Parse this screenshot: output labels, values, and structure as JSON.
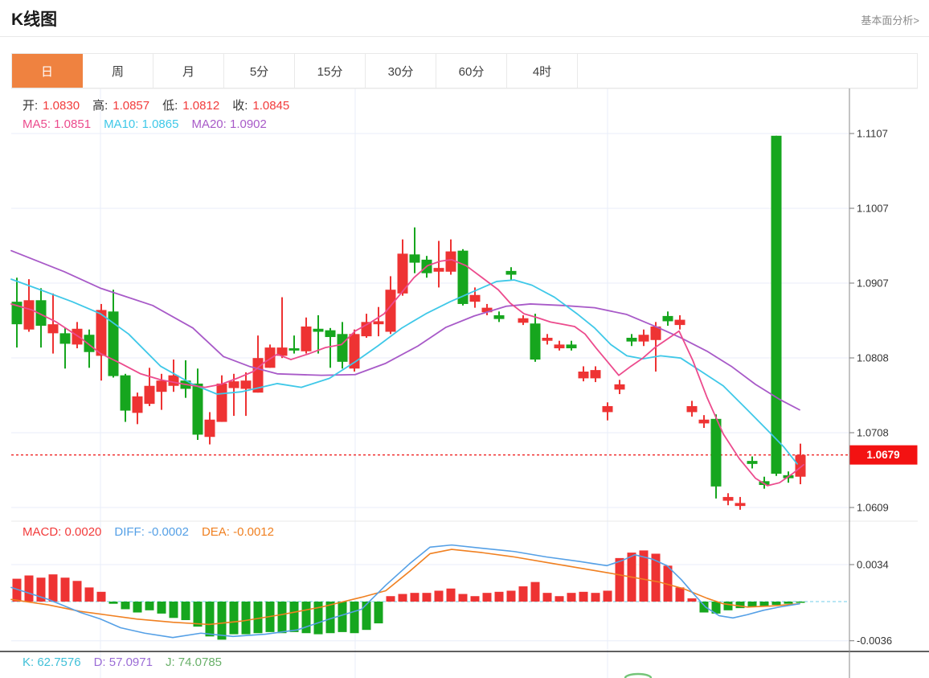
{
  "header": {
    "title": "K线图",
    "link_label": "基本面分析>"
  },
  "tabs": {
    "items": [
      "日",
      "周",
      "月",
      "5分",
      "15分",
      "30分",
      "60分",
      "4时"
    ],
    "active_index": 0
  },
  "colors": {
    "accent_tab": "#ef8240",
    "candle_red": "#ee3333",
    "candle_green": "#16a61e",
    "ma5": "#ec4b8d",
    "ma10": "#3fc8e8",
    "ma20": "#a85ac8",
    "value_red": "#f23b3b",
    "diff_blue": "#55a0e6",
    "dea_orange": "#f08021",
    "kdj_k": "#40c0d8",
    "kdj_d": "#9b6cd6",
    "kdj_j": "#69b069",
    "badge_red": "#f31212",
    "grid": "#e8eef8",
    "zero_dash": "#8ed7ee"
  },
  "main_chart": {
    "ohlc": [
      {
        "label": "开:",
        "value": "1.0830"
      },
      {
        "label": "高:",
        "value": "1.0857"
      },
      {
        "label": "低:",
        "value": "1.0812"
      },
      {
        "label": "收:",
        "value": "1.0845"
      }
    ],
    "ma_items": [
      {
        "text": "MA5: 1.0851",
        "color_key": "ma5"
      },
      {
        "text": "MA10: 1.0865",
        "color_key": "ma10"
      },
      {
        "text": "MA20: 1.0902",
        "color_key": "ma20"
      }
    ],
    "y_axis": [
      "1.1107",
      "1.1007",
      "1.0907",
      "1.0808",
      "1.0708",
      "1.0609"
    ],
    "last_price": "1.0679"
  },
  "macd_panel": {
    "items": [
      {
        "text": "MACD: 0.0020",
        "color_key": "value_red"
      },
      {
        "text": "DIFF: -0.0002",
        "color_key": "diff_blue"
      },
      {
        "text": "DEA: -0.0012",
        "color_key": "dea_orange"
      }
    ],
    "y_axis": [
      "0.0034",
      "-0.0036"
    ]
  },
  "kdj_panel": {
    "items": [
      {
        "text": "K: 62.7576",
        "color_key": "kdj_k"
      },
      {
        "text": "D: 57.0971",
        "color_key": "kdj_d"
      },
      {
        "text": "J: 74.0785",
        "color_key": "kdj_j"
      }
    ]
  },
  "chart_data": {
    "type": "candlestick",
    "title": "K线图 日线 (EUR/USD style quotes)",
    "price_axis": {
      "ticks": [
        1.1107,
        1.1007,
        1.0907,
        1.0808,
        1.0708,
        1.0609
      ],
      "last_price": 1.0679
    },
    "macd_axis": {
      "ticks": [
        0.0034,
        -0.0036
      ]
    },
    "candles_note": "each candle = [color r|g, bodyTop, bodyBottom, high, low] in price units, left to right",
    "candles": [
      [
        "g",
        1.0883,
        1.0853,
        1.0915,
        1.0822
      ],
      [
        "r",
        1.0885,
        1.0846,
        1.0913,
        1.0843
      ],
      [
        "g",
        1.0885,
        1.0851,
        1.0901,
        1.0822
      ],
      [
        "r",
        1.0853,
        1.0841,
        1.0894,
        1.0814
      ],
      [
        "g",
        1.0841,
        1.0827,
        1.0848,
        1.0794
      ],
      [
        "r",
        1.0847,
        1.0826,
        1.0856,
        1.0821
      ],
      [
        "g",
        1.0839,
        1.0816,
        1.0846,
        1.0795
      ],
      [
        "r",
        1.0872,
        1.0811,
        1.088,
        1.0778
      ],
      [
        "g",
        1.087,
        1.0784,
        1.0899,
        1.0782
      ],
      [
        "g",
        1.0785,
        1.0738,
        1.0787,
        1.0723
      ],
      [
        "r",
        1.0757,
        1.0735,
        1.0762,
        1.072
      ],
      [
        "r",
        1.0771,
        1.0747,
        1.0795,
        1.0744
      ],
      [
        "r",
        1.0778,
        1.0763,
        1.0787,
        1.0739
      ],
      [
        "r",
        1.0785,
        1.0771,
        1.0806,
        1.0763
      ],
      [
        "g",
        1.0778,
        1.0767,
        1.0805,
        1.0755
      ],
      [
        "g",
        1.0774,
        1.0706,
        1.0794,
        1.0699
      ],
      [
        "r",
        1.0726,
        1.0703,
        1.0736,
        1.0693
      ],
      [
        "r",
        1.0774,
        1.0723,
        1.0785,
        1.0723
      ],
      [
        "r",
        1.0777,
        1.0768,
        1.0787,
        1.0731
      ],
      [
        "r",
        1.0778,
        1.0767,
        1.0789,
        1.0731
      ],
      [
        "r",
        1.0808,
        1.0762,
        1.0838,
        1.0762
      ],
      [
        "r",
        1.0822,
        1.0795,
        1.0826,
        1.0795
      ],
      [
        "r",
        1.0822,
        1.0811,
        1.0889,
        1.0808
      ],
      [
        "g",
        1.0821,
        1.0818,
        1.0838,
        1.0814
      ],
      [
        "r",
        1.085,
        1.0817,
        1.0862,
        1.0814
      ],
      [
        "g",
        1.0847,
        1.0843,
        1.0865,
        1.0814
      ],
      [
        "g",
        1.0845,
        1.0836,
        1.0848,
        1.0795
      ],
      [
        "g",
        1.084,
        1.0803,
        1.0856,
        1.0794
      ],
      [
        "r",
        1.084,
        1.0794,
        1.0846,
        1.079
      ],
      [
        "r",
        1.0856,
        1.0837,
        1.0867,
        1.0835
      ],
      [
        "r",
        1.0857,
        1.0853,
        1.0876,
        1.0837
      ],
      [
        "r",
        1.0899,
        1.0843,
        1.0917,
        1.084
      ],
      [
        "r",
        1.0947,
        1.0894,
        1.0966,
        1.0891
      ],
      [
        "g",
        1.0946,
        1.0935,
        1.0982,
        1.0921
      ],
      [
        "g",
        1.0939,
        1.0921,
        1.0944,
        1.0915
      ],
      [
        "r",
        1.0928,
        1.0923,
        1.0964,
        1.0902
      ],
      [
        "r",
        1.095,
        1.0923,
        1.0966,
        1.0919
      ],
      [
        "g",
        1.0951,
        1.088,
        1.0953,
        1.0878
      ],
      [
        "r",
        1.0892,
        1.0883,
        1.0902,
        1.0875
      ],
      [
        "r",
        1.0875,
        1.0869,
        1.088,
        1.0865
      ],
      [
        "g",
        1.0865,
        1.086,
        1.087,
        1.0856
      ],
      [
        "g",
        1.0924,
        1.0919,
        1.0929,
        1.0912
      ],
      [
        "r",
        1.0861,
        1.0855,
        1.0865,
        1.0852
      ],
      [
        "g",
        1.0854,
        1.0806,
        1.0867,
        1.0803
      ],
      [
        "r",
        1.0835,
        1.0831,
        1.084,
        1.0826
      ],
      [
        "r",
        1.0826,
        1.0821,
        1.0831,
        1.0818
      ],
      [
        "g",
        1.0826,
        1.0821,
        1.0831,
        1.0818
      ],
      [
        "r",
        1.079,
        1.0781,
        1.0797,
        1.0777
      ],
      [
        "r",
        1.0792,
        1.0781,
        1.0797,
        1.0776
      ],
      [
        "r",
        1.0744,
        1.0736,
        1.0749,
        1.0725
      ],
      [
        "r",
        1.0773,
        1.0766,
        1.0779,
        1.076
      ],
      [
        "g",
        1.0835,
        1.083,
        1.084,
        1.0824
      ],
      [
        "r",
        1.0839,
        1.083,
        1.0846,
        1.0824
      ],
      [
        "r",
        1.085,
        1.0832,
        1.0856,
        1.079
      ],
      [
        "g",
        1.0864,
        1.0857,
        1.087,
        1.0851
      ],
      [
        "r",
        1.0859,
        1.0852,
        1.0865,
        1.0846
      ],
      [
        "r",
        1.0744,
        1.0736,
        1.0751,
        1.073
      ],
      [
        "r",
        1.0726,
        1.0721,
        1.0732,
        1.0715
      ],
      [
        "g",
        1.0727,
        1.0637,
        1.0733,
        1.0621
      ],
      [
        "r",
        1.0623,
        1.0618,
        1.0628,
        1.0612
      ],
      [
        "r",
        1.0615,
        1.0611,
        1.0623,
        1.0606
      ],
      [
        "g",
        1.0671,
        1.0667,
        1.0677,
        1.0661
      ],
      [
        "g",
        1.0644,
        1.0639,
        1.065,
        1.0634
      ],
      [
        "g",
        1.1104,
        1.0654,
        1.1104,
        1.0651
      ],
      [
        "g",
        1.0652,
        1.0648,
        1.0657,
        1.0642
      ],
      [
        "r",
        1.0679,
        1.065,
        1.0694,
        1.064
      ]
    ],
    "ma5_points": [
      [
        14,
        1.088
      ],
      [
        40,
        1.0872
      ],
      [
        70,
        1.0856
      ],
      [
        100,
        1.0835
      ],
      [
        125,
        1.0814
      ],
      [
        150,
        1.0801
      ],
      [
        175,
        1.0787
      ],
      [
        200,
        1.0779
      ],
      [
        230,
        1.0773
      ],
      [
        255,
        1.0769
      ],
      [
        275,
        1.0773
      ],
      [
        295,
        1.0781
      ],
      [
        315,
        1.079
      ],
      [
        330,
        1.0803
      ],
      [
        345,
        1.0813
      ],
      [
        362,
        1.0806
      ],
      [
        385,
        1.0814
      ],
      [
        405,
        1.0822
      ],
      [
        425,
        1.0826
      ],
      [
        442,
        1.0844
      ],
      [
        462,
        1.0856
      ],
      [
        478,
        1.0867
      ],
      [
        495,
        1.0889
      ],
      [
        515,
        1.0915
      ],
      [
        532,
        1.0931
      ],
      [
        548,
        1.0937
      ],
      [
        562,
        1.0939
      ],
      [
        580,
        1.0931
      ],
      [
        600,
        1.0915
      ],
      [
        620,
        1.0899
      ],
      [
        635,
        1.0881
      ],
      [
        652,
        1.0867
      ],
      [
        668,
        1.0862
      ],
      [
        685,
        1.0856
      ],
      [
        700,
        1.0853
      ],
      [
        715,
        1.085
      ],
      [
        728,
        1.084
      ],
      [
        742,
        1.0821
      ],
      [
        756,
        1.0803
      ],
      [
        770,
        1.0785
      ],
      [
        785,
        1.0797
      ],
      [
        800,
        1.0808
      ],
      [
        815,
        1.0822
      ],
      [
        830,
        1.0833
      ],
      [
        845,
        1.0844
      ],
      [
        862,
        1.0805
      ],
      [
        880,
        1.0755
      ],
      [
        900,
        1.0707
      ],
      [
        920,
        1.0674
      ],
      [
        940,
        1.0648
      ],
      [
        955,
        1.0638
      ],
      [
        970,
        1.0642
      ],
      [
        985,
        1.0653
      ],
      [
        1000,
        1.0666
      ]
    ],
    "ma10_points": [
      [
        14,
        1.0913
      ],
      [
        50,
        1.0899
      ],
      [
        90,
        1.0883
      ],
      [
        125,
        1.0867
      ],
      [
        160,
        1.084
      ],
      [
        200,
        1.0797
      ],
      [
        240,
        1.0773
      ],
      [
        270,
        1.076
      ],
      [
        300,
        1.0763
      ],
      [
        345,
        1.0774
      ],
      [
        375,
        1.0769
      ],
      [
        410,
        1.0781
      ],
      [
        442,
        1.0803
      ],
      [
        470,
        1.0824
      ],
      [
        500,
        1.0848
      ],
      [
        530,
        1.0867
      ],
      [
        560,
        1.0883
      ],
      [
        590,
        1.0897
      ],
      [
        618,
        1.091
      ],
      [
        640,
        1.0912
      ],
      [
        662,
        1.0905
      ],
      [
        690,
        1.0889
      ],
      [
        718,
        1.0867
      ],
      [
        740,
        1.0848
      ],
      [
        760,
        1.0826
      ],
      [
        780,
        1.0811
      ],
      [
        800,
        1.0807
      ],
      [
        822,
        1.0811
      ],
      [
        847,
        1.0808
      ],
      [
        870,
        1.0792
      ],
      [
        900,
        1.0771
      ],
      [
        930,
        1.0739
      ],
      [
        955,
        1.0712
      ],
      [
        975,
        1.069
      ],
      [
        992,
        1.0667
      ]
    ],
    "ma20_points": [
      [
        14,
        1.0951
      ],
      [
        80,
        1.0923
      ],
      [
        125,
        1.0901
      ],
      [
        190,
        1.0878
      ],
      [
        240,
        1.0848
      ],
      [
        278,
        1.081
      ],
      [
        310,
        1.0797
      ],
      [
        345,
        1.0787
      ],
      [
        400,
        1.0785
      ],
      [
        442,
        1.0786
      ],
      [
        480,
        1.0801
      ],
      [
        520,
        1.0824
      ],
      [
        555,
        1.0849
      ],
      [
        590,
        1.0864
      ],
      [
        630,
        1.0877
      ],
      [
        660,
        1.088
      ],
      [
        700,
        1.0878
      ],
      [
        740,
        1.0875
      ],
      [
        780,
        1.0866
      ],
      [
        820,
        1.0848
      ],
      [
        847,
        1.0835
      ],
      [
        880,
        1.0817
      ],
      [
        910,
        1.0797
      ],
      [
        940,
        1.0773
      ],
      [
        970,
        1.0753
      ],
      [
        995,
        1.0739
      ]
    ],
    "macd_hist_1e4": [
      21,
      24,
      22,
      25,
      22,
      19,
      13,
      9,
      -2,
      -7,
      -10,
      -8,
      -11,
      -15,
      -17,
      -23,
      -32,
      -35,
      -30,
      -30,
      -29,
      -28,
      -29,
      -28,
      -29,
      -30,
      -29,
      -28,
      -29,
      -26,
      -20,
      5,
      7,
      8,
      8,
      10,
      12,
      7,
      5,
      8,
      9,
      10,
      14,
      18,
      8,
      5,
      8,
      9,
      8,
      10,
      40,
      45,
      47,
      44,
      33,
      13,
      3,
      -10,
      -11,
      -8,
      -6,
      -5,
      -4,
      -3,
      -2,
      -1
    ],
    "diff_points_1e4": [
      [
        14,
        13
      ],
      [
        60,
        2
      ],
      [
        100,
        -10
      ],
      [
        125,
        -16
      ],
      [
        150,
        -24
      ],
      [
        180,
        -29
      ],
      [
        215,
        -33
      ],
      [
        250,
        -29
      ],
      [
        290,
        -32
      ],
      [
        330,
        -30
      ],
      [
        370,
        -26
      ],
      [
        410,
        -16
      ],
      [
        450,
        -7
      ],
      [
        480,
        15
      ],
      [
        510,
        35
      ],
      [
        535,
        50
      ],
      [
        562,
        52
      ],
      [
        600,
        49
      ],
      [
        640,
        46
      ],
      [
        680,
        41
      ],
      [
        720,
        37
      ],
      [
        755,
        33
      ],
      [
        775,
        38
      ],
      [
        790,
        43
      ],
      [
        812,
        39
      ],
      [
        830,
        33
      ],
      [
        848,
        20
      ],
      [
        862,
        8
      ],
      [
        878,
        -5
      ],
      [
        895,
        -13
      ],
      [
        912,
        -15
      ],
      [
        930,
        -12
      ],
      [
        950,
        -8
      ],
      [
        970,
        -5
      ],
      [
        995,
        -2
      ]
    ],
    "dea_points_1e4": [
      [
        14,
        2
      ],
      [
        60,
        -3
      ],
      [
        100,
        -9
      ],
      [
        130,
        -12
      ],
      [
        170,
        -16
      ],
      [
        215,
        -19
      ],
      [
        260,
        -21
      ],
      [
        300,
        -18
      ],
      [
        350,
        -12
      ],
      [
        400,
        -5
      ],
      [
        450,
        4
      ],
      [
        480,
        10
      ],
      [
        510,
        28
      ],
      [
        535,
        44
      ],
      [
        562,
        48
      ],
      [
        600,
        45
      ],
      [
        640,
        41
      ],
      [
        680,
        36
      ],
      [
        720,
        31
      ],
      [
        760,
        26
      ],
      [
        790,
        22
      ],
      [
        820,
        18
      ],
      [
        850,
        12
      ],
      [
        880,
        3
      ],
      [
        900,
        -2
      ],
      [
        930,
        -5
      ],
      [
        960,
        -4
      ],
      [
        995,
        -2
      ]
    ]
  }
}
